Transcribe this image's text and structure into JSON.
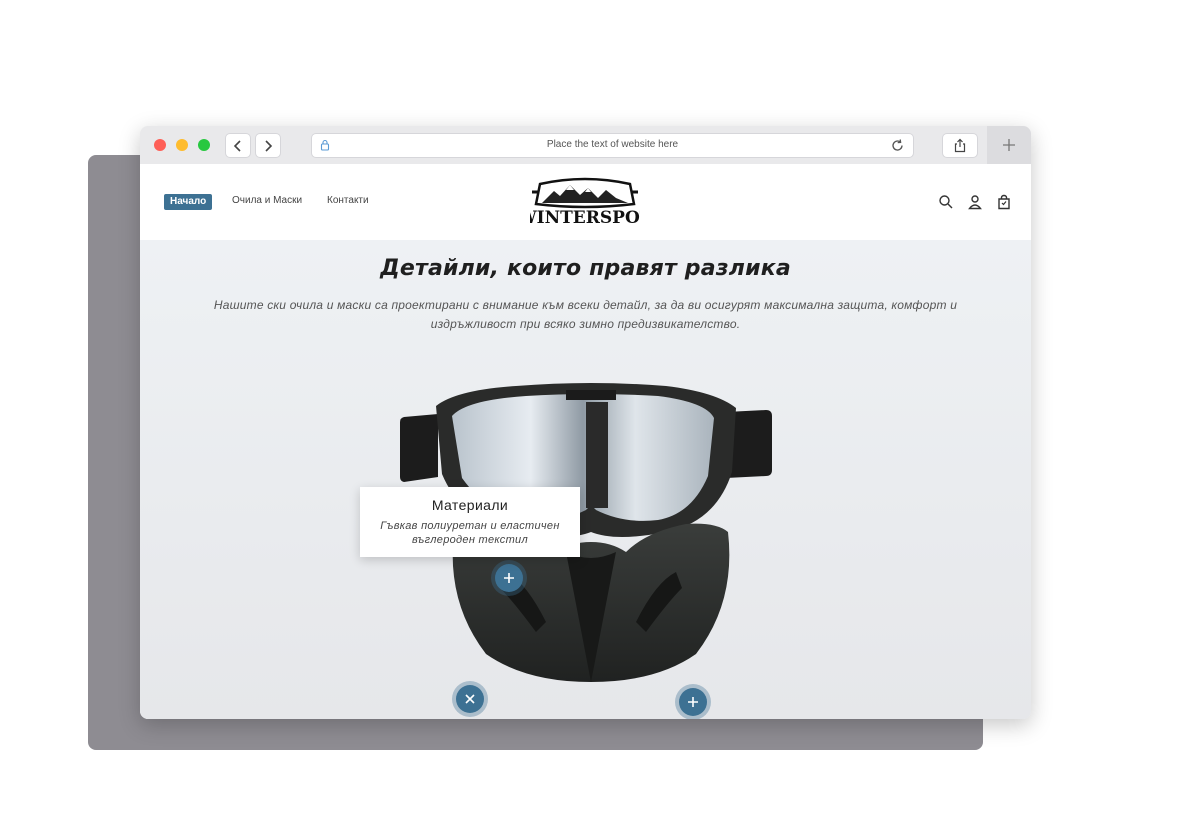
{
  "browser": {
    "url_placeholder": "Place the text of website here"
  },
  "header": {
    "nav": [
      {
        "label": "Начало"
      },
      {
        "label": "Очила и Маски"
      },
      {
        "label": "Контакти"
      }
    ],
    "logo_text": "WINTERSPOT"
  },
  "main": {
    "heading": "Детайли, които правят разлика",
    "subtext": "Нашите ски очила и маски са проектирани с внимание към всеки детайл, за да ви осигурят максимална защита, комфорт и издръжливост при всяко зимно предизвикателство."
  },
  "tooltip": {
    "title": "Материали",
    "text": "Гъвкав полиуретан и еластичен въглероден текстил"
  },
  "colors": {
    "accent": "#3d7193",
    "dark_text": "#1f1f1f"
  }
}
